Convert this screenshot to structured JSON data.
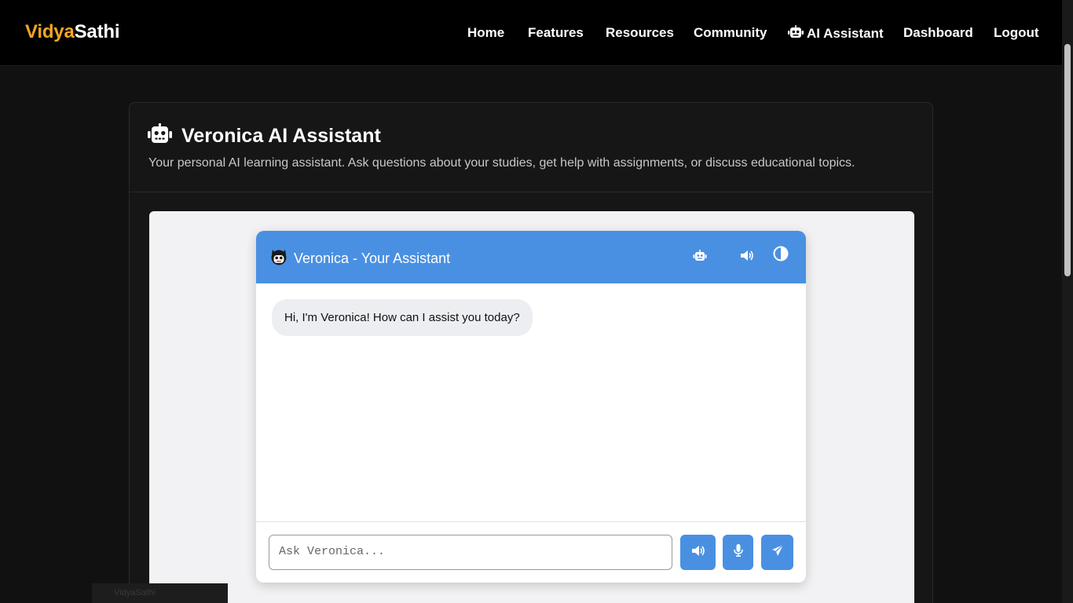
{
  "brand": {
    "part1": "Vidya",
    "part2": "Sathi"
  },
  "nav": {
    "items": [
      {
        "label": "Home",
        "icon": ""
      },
      {
        "label": "Features",
        "icon": ""
      },
      {
        "label": "Resources",
        "icon": ""
      },
      {
        "label": "Community",
        "icon": ""
      },
      {
        "label": "AI Assistant",
        "icon": "robot-icon"
      },
      {
        "label": "Dashboard",
        "icon": ""
      },
      {
        "label": "Logout",
        "icon": ""
      }
    ]
  },
  "page": {
    "title": "Veronica AI Assistant",
    "title_icon": "robot-icon",
    "description": "Your personal AI learning assistant. Ask questions about your studies, get help with assignments, or discuss educational topics."
  },
  "chat": {
    "header_title": "Veronica - Your Assistant",
    "header_icons": [
      "veronica-avatar-icon",
      "robot-icon",
      "speaker-icon",
      "theme-toggle-icon"
    ],
    "messages": [
      {
        "sender": "assistant",
        "text": "Hi, I'm Veronica! How can I assist you today?"
      }
    ],
    "input_placeholder": "Ask Veronica...",
    "input_value": "",
    "action_icons": [
      "speaker-icon",
      "microphone-icon",
      "send-icon"
    ]
  },
  "toast": {
    "text": "VidyaSathi"
  },
  "colors": {
    "brand_accent": "#f5a623",
    "chat_primary": "#4a90e2",
    "page_background": "#111111",
    "navbar_background": "#000000"
  }
}
